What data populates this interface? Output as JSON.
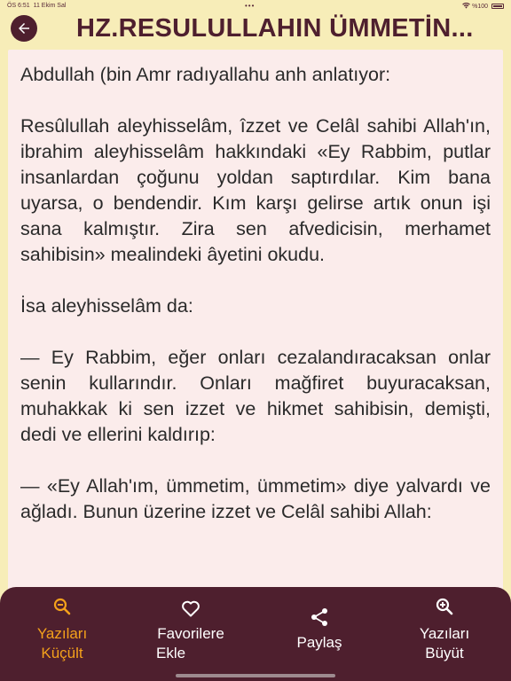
{
  "status_bar": {
    "time": "ÖS 6:51",
    "date": "11 Ekim Sal",
    "dots": "•••",
    "battery": "%100"
  },
  "header": {
    "title": "HZ.RESULULLAHIN ÜMMETİN..."
  },
  "article": {
    "text": "Abdullah (bin Amr radıyallahu anh anlatıyor:\n\nResûlullah aleyhisselâm, îzzet ve Celâl sahibi Allah'ın, ibrahim aleyhisselâm hakkındaki «Ey Rabbim, putlar insanlardan çoğunu yoldan saptırdılar. Kim bana uyarsa, o bendendir. Kım karşı gelirse artık onun işi sana kalmıştır. Zira sen afvedicisin, merhamet sahibisin» mealindeki âyetini okudu.\n\nİsa aleyhisselâm da:\n\n— Ey Rabbim, eğer onları cezalandıracaksan onlar senin kullarındır. Onları mağfiret buyuracaksan, muhakkak ki sen izzet ve hikmet sahibisin, demişti, dedi ve ellerini kaldırıp:\n\n— «Ey Allah'ım, ümmetim, ümmetim» diye yalvardı ve ağladı. Bunun üzerine izzet ve Celâl sahibi Allah:"
  },
  "bottom_bar": {
    "tabs": [
      {
        "line1": "Yazıları",
        "line2": "Küçült",
        "icon": "zoom-out-icon",
        "active": true
      },
      {
        "line1": "Favorilere",
        "line2": "Ekle",
        "icon": "heart-icon",
        "active": false
      },
      {
        "line1": "Paylaş",
        "line2": "",
        "icon": "share-icon",
        "active": false
      },
      {
        "line1": "Yazıları",
        "line2": "Büyüt",
        "icon": "zoom-in-icon",
        "active": false
      }
    ]
  },
  "colors": {
    "accent": "#4e1f2e",
    "active_tab": "#f4a11b",
    "page_background": "#f7edb8",
    "card_background": "#fbeceb"
  }
}
